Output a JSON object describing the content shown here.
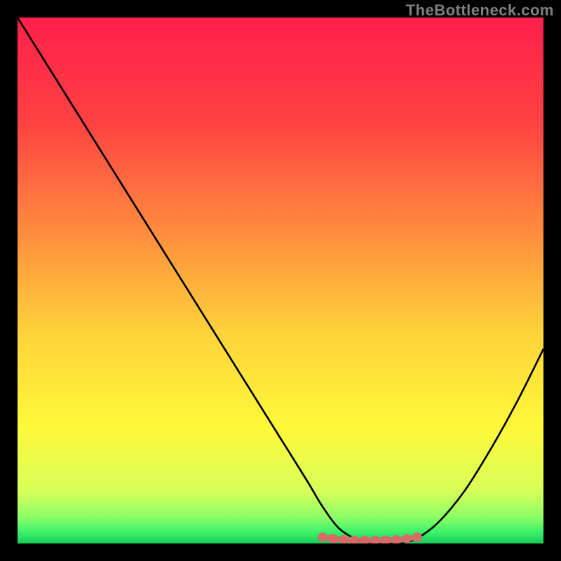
{
  "watermark": "TheBottleneck.com",
  "chart_data": {
    "type": "line",
    "title": "",
    "xlabel": "",
    "ylabel": "",
    "xlim": [
      0,
      100
    ],
    "ylim": [
      0,
      100
    ],
    "gradient_stops": [
      {
        "offset": 0,
        "color": "#ff1f4b"
      },
      {
        "offset": 20,
        "color": "#ff4242"
      },
      {
        "offset": 40,
        "color": "#ff8a3e"
      },
      {
        "offset": 60,
        "color": "#ffd33a"
      },
      {
        "offset": 78,
        "color": "#fff93a"
      },
      {
        "offset": 90,
        "color": "#d7ff59"
      },
      {
        "offset": 95,
        "color": "#8cff66"
      },
      {
        "offset": 98,
        "color": "#39f06a"
      },
      {
        "offset": 100,
        "color": "#16c95a"
      }
    ],
    "series": [
      {
        "name": "bottleneck-curve",
        "x": [
          0,
          5,
          10,
          15,
          20,
          25,
          30,
          35,
          40,
          45,
          50,
          55,
          58,
          61,
          64,
          67,
          70,
          73,
          76,
          80,
          85,
          90,
          95,
          100
        ],
        "values": [
          100,
          92,
          84,
          76,
          68,
          60,
          52,
          44,
          36,
          28,
          20,
          12,
          7,
          3,
          1,
          0,
          0,
          0,
          1,
          4,
          10,
          18,
          27,
          37
        ]
      }
    ],
    "markers": {
      "name": "optimal-range",
      "color": "#d86a68",
      "x": [
        58,
        60,
        62,
        64,
        66,
        68,
        70,
        72,
        74,
        76
      ],
      "values": [
        1.2,
        0.9,
        0.7,
        0.6,
        0.6,
        0.6,
        0.6,
        0.7,
        0.9,
        1.2
      ]
    }
  }
}
